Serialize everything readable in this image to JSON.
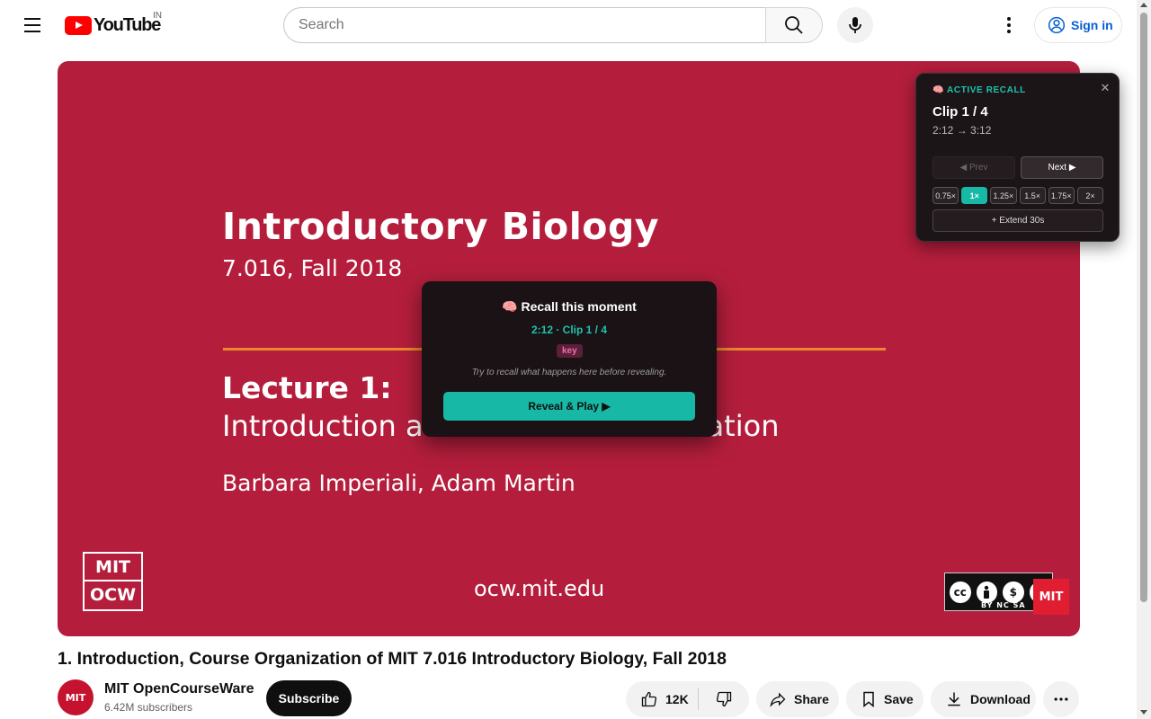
{
  "header": {
    "logo_text": "YouTube",
    "country_code": "IN",
    "search_placeholder": "Search",
    "signin_label": "Sign in"
  },
  "slide": {
    "title": "Introductory Biology",
    "subtitle": "7.016, Fall 2018",
    "lecture": "Lecture 1:",
    "lecture_sub": "Introduction a",
    "lecture_sub_tail": "ation",
    "authors": "Barbara Imperiali, Adam Martin",
    "url": "ocw.mit.edu",
    "ocw_line1": "MIT",
    "ocw_line2": "OCW",
    "cc_label": "cc",
    "cc_terms": "BY  NC  SA",
    "corner_logo": "MIT"
  },
  "recall_modal": {
    "title": "🧠 Recall this moment",
    "meta": "2:12 · Clip 1 / 4",
    "tag": "key",
    "hint": "Try to recall what happens here before revealing.",
    "reveal_label": "Reveal & Play ▶"
  },
  "recall_panel": {
    "heading": "🧠 ACTIVE RECALL",
    "close_label": "✕",
    "clip_label": "Clip 1 / 4",
    "range": "2:12 → 3:12",
    "prev_label": "◀ Prev",
    "next_label": "Next ▶",
    "speeds": [
      "0.75×",
      "1×",
      "1.25×",
      "1.5×",
      "1.75×",
      "2×"
    ],
    "active_speed": "1×",
    "extend_label": "+ Extend 30s",
    "accent_color": "#17b8a6"
  },
  "video": {
    "title": "1. Introduction, Course Organization of MIT 7.016 Introductory Biology, Fall 2018",
    "channel_name": "MIT OpenCourseWare",
    "channel_avatar": "MIT",
    "subscribers": "6.42M subscribers",
    "subscribe_label": "Subscribe",
    "like_count": "12K",
    "share_label": "Share",
    "save_label": "Save",
    "download_label": "Download"
  }
}
